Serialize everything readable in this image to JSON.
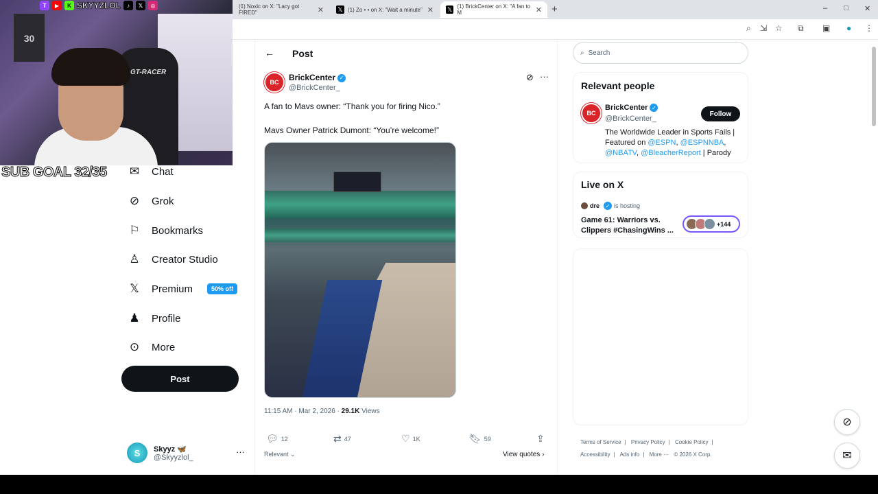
{
  "browser": {
    "tabs": [
      {
        "title": "(1) Noxic on X: \"Lacy got FIRED\"",
        "icon": "x-logo"
      },
      {
        "title": "(1) Zo • • on X: \"Wait a minute\"",
        "icon": "x-logo"
      },
      {
        "title": "(1) BrickCenter on X: \"A fan to M",
        "icon": "x-logo"
      }
    ],
    "new_tab": "+",
    "window_controls": [
      "–",
      "□",
      "✕"
    ]
  },
  "overlay": {
    "handle": "SKYYZLOL",
    "sub_goal": "SUB GOAL 32/35",
    "jersey_number": "30",
    "chair_brand": "GT-RACER"
  },
  "nav": {
    "items": [
      {
        "label": "Chat",
        "icon": "envelope-icon"
      },
      {
        "label": "Grok",
        "icon": "grok-icon"
      },
      {
        "label": "Bookmarks",
        "icon": "bookmark-icon"
      },
      {
        "label": "Creator Studio",
        "icon": "creator-studio-icon"
      },
      {
        "label": "Premium",
        "icon": "x-logo-icon",
        "badge": "50% off"
      },
      {
        "label": "Profile",
        "icon": "person-icon"
      },
      {
        "label": "More",
        "icon": "more-circle-icon"
      }
    ],
    "post_button": "Post",
    "account": {
      "name": "Skyyz 🦋",
      "handle": "@Skyyzlol_",
      "avatar_letter": "S"
    }
  },
  "post": {
    "header_title": "Post",
    "author": {
      "name": "BrickCenter",
      "handle": "@BrickCenter_",
      "avatar_text": "BC"
    },
    "text_line1": "A fan to Mavs owner: “Thank you for firing Nico.”",
    "text_line2": "Mavs Owner Patrick Dumont: “You’re welcome!”",
    "timestamp": "11:15 AM · Mar 2, 2026 · ",
    "views_count": "29.1K",
    "views_label": " Views",
    "replies": "12",
    "reposts": "47",
    "likes": "1K",
    "bookmarks": "59",
    "relevant_label": "Relevant",
    "view_quotes": "View quotes"
  },
  "right": {
    "search_placeholder": "Search",
    "relevant_people": {
      "title": "Relevant people",
      "name": "BrickCenter",
      "handle": "@BrickCenter_",
      "follow": "Follow",
      "bio_plain1": "The Worldwide Leader in Sports Fails | Featured on ",
      "bio_link1": "@ESPN",
      "bio_sep1": ", ",
      "bio_link2": "@ESPNNBA",
      "bio_sep2": ", ",
      "bio_link3": "@NBATV",
      "bio_sep3": ", ",
      "bio_link4": "@BleacherReport",
      "bio_plain2": " | Parody"
    },
    "live": {
      "title": "Live on X",
      "host": "dre",
      "hosting": "is hosting",
      "space_title": "Game 61: Warriors vs. Clippers #ChasingWins ...",
      "listeners": "+144"
    },
    "footer": [
      "Terms of Service",
      "|",
      "Privacy Policy",
      "|",
      "Cookie Policy",
      "|",
      "Accessibility",
      "|",
      "Ads info",
      "|",
      "More ···",
      "© 2026 X Corp."
    ]
  }
}
